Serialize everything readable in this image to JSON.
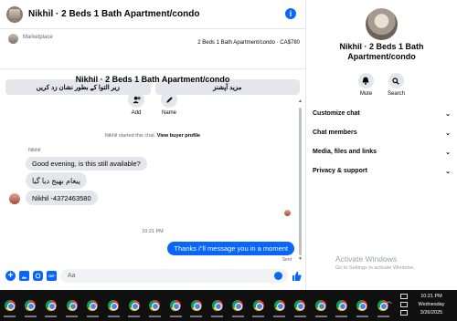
{
  "header": {
    "title": "Nikhil · 2 Beds 1 Bath Apartment/condo"
  },
  "marketplace": {
    "label": "Marketplace",
    "listing": "2 Beds 1 Bath Apartment/condo · CA$780",
    "quick_replies": [
      "زیر التوا کے بطور نشان زد کریں",
      "مزید آپشنز"
    ]
  },
  "intro": {
    "title": "Nikhil · 2 Beds 1 Bath Apartment/condo",
    "actions": [
      {
        "label": "Add",
        "icon": "add-person-icon"
      },
      {
        "label": "Name",
        "icon": "pencil-icon"
      }
    ],
    "note_prefix": "Nikhil started this chat.",
    "note_link": "View buyer profile"
  },
  "messages": {
    "sender": "Nikhil",
    "incoming": [
      "Good evening, is this still available?",
      "پیغام بھیج دیا گیا",
      "Nikhil -4372463580"
    ],
    "time_separator": "10:21 PM",
    "outgoing": "Thanks i''ll message you in a moment",
    "status": "Sent"
  },
  "composer": {
    "placeholder": "Aa"
  },
  "details": {
    "title": "Nikhil · 2 Beds 1 Bath Apartment/condo",
    "actions": [
      {
        "label": "Mute",
        "icon": "bell-icon"
      },
      {
        "label": "Search",
        "icon": "search-icon"
      }
    ],
    "menu": [
      "Customize chat",
      "Chat members",
      "Media, files and links",
      "Privacy & support"
    ]
  },
  "watermark": {
    "title": "Activate Windows",
    "subtitle": "Go to Settings to activate Windows."
  },
  "taskbar": {
    "app_count": 19,
    "clock_time": "10:21 PM",
    "clock_day": "Wednesday",
    "clock_date": "3/26/2025"
  },
  "colors": {
    "accent": "#0866ff",
    "bubble_in": "#e4e6eb",
    "taskbar": "#101010"
  }
}
